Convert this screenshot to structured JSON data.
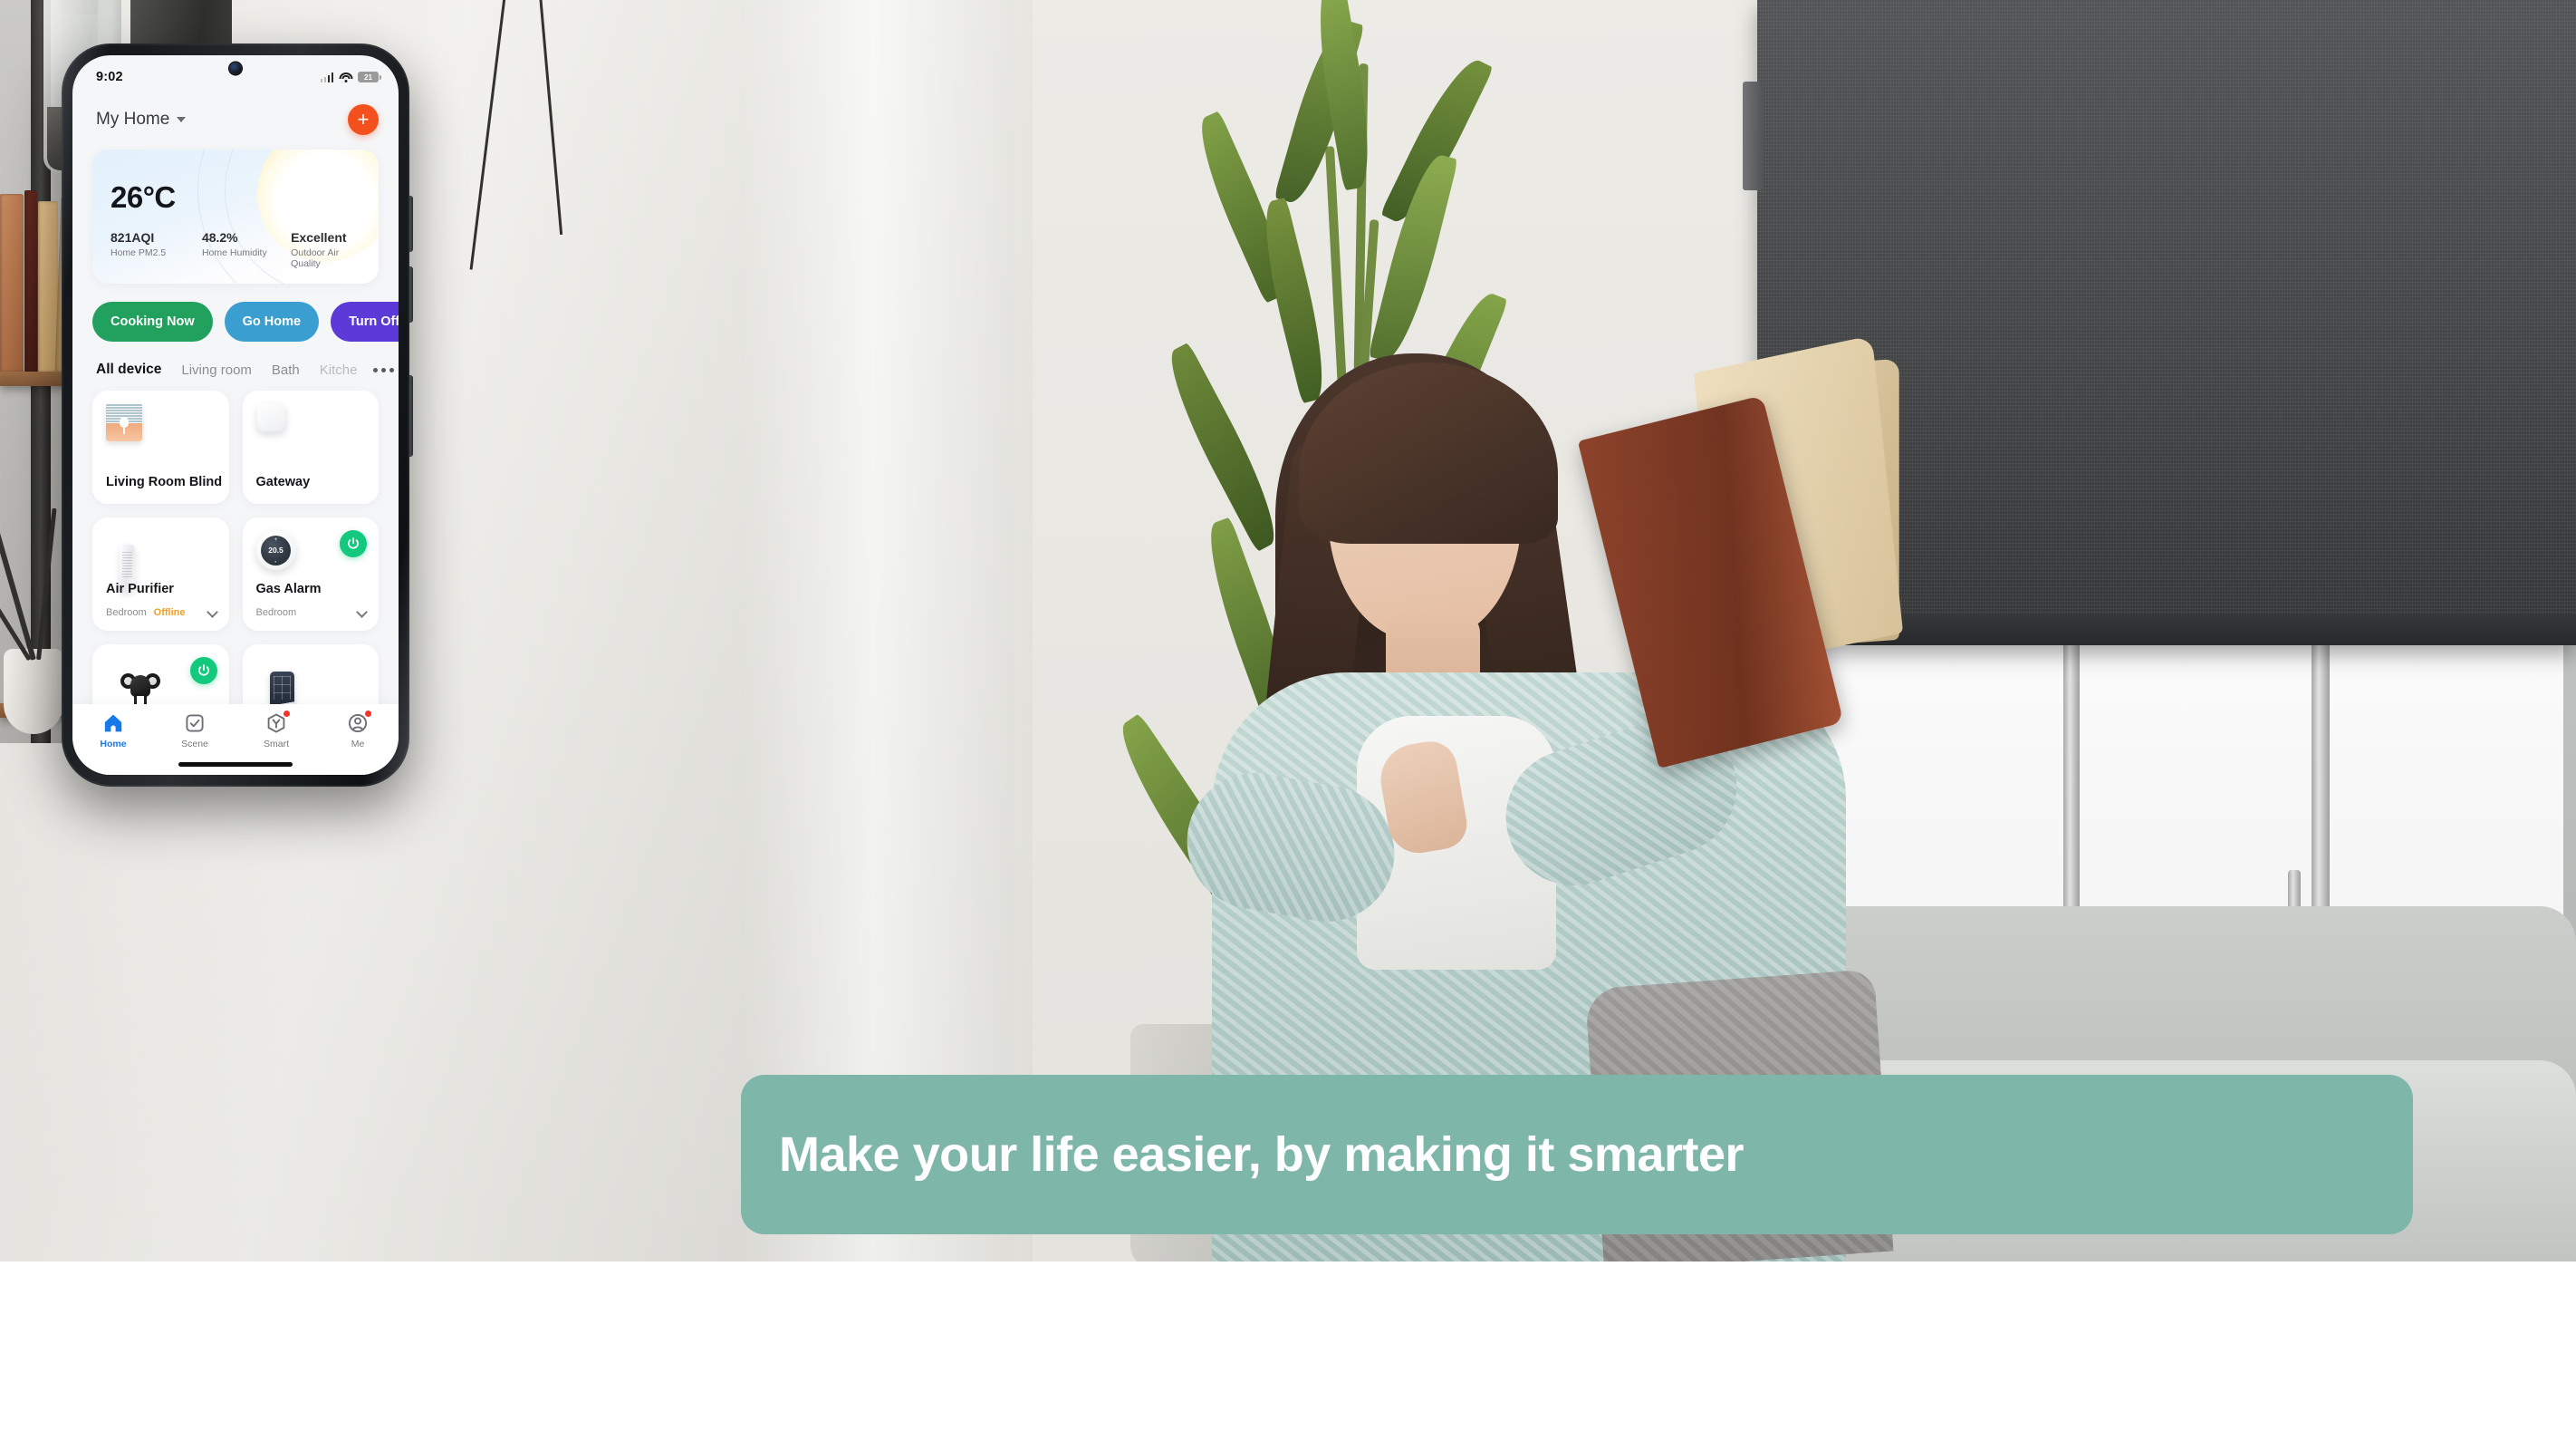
{
  "banner": {
    "text": "Make your life easier, by making it smarter",
    "bg_color": "#7eb6aa",
    "text_color": "#ffffff"
  },
  "phone": {
    "status_bar": {
      "time": "9:02",
      "battery_level": "21",
      "signal_icon": "cellular-signal-icon",
      "wifi_icon": "wifi-icon",
      "battery_icon": "battery-icon"
    },
    "header": {
      "home_name": "My Home",
      "dropdown_icon": "chevron-down-icon",
      "add_label": "+",
      "add_icon": "plus-icon",
      "add_color": "#f4501e"
    },
    "weather_card": {
      "temperature": "26°C",
      "stats": [
        {
          "value": "821AQI",
          "label": "Home PM2.5"
        },
        {
          "value": "48.2%",
          "label": "Home Humidity"
        },
        {
          "value": "Excellent",
          "label": "Outdoor Air Quality"
        }
      ]
    },
    "scenes": [
      {
        "label": "Cooking Now",
        "color": "#22a05e"
      },
      {
        "label": "Go Home",
        "color": "#3a9fd0"
      },
      {
        "label": "Turn Off All Li",
        "color": "#5b3ad8"
      }
    ],
    "tabs": [
      {
        "label": "All device",
        "state": "active"
      },
      {
        "label": "Living room",
        "state": "normal"
      },
      {
        "label": "Bath",
        "state": "normal"
      },
      {
        "label": "Kitche",
        "state": "faded"
      }
    ],
    "tabs_more_icon": "more-horizontal-icon",
    "devices": [
      {
        "name": "Living Room Blind",
        "room": "",
        "status": "",
        "icon": "window-blind-icon",
        "power": false,
        "chevron": false
      },
      {
        "name": "Gateway",
        "room": "",
        "status": "",
        "icon": "gateway-hub-icon",
        "power": false,
        "chevron": false
      },
      {
        "name": "Air Purifier",
        "room": "Bedroom",
        "status": "Offline",
        "icon": "air-purifier-icon",
        "power": false,
        "chevron": true
      },
      {
        "name": "Gas Alarm",
        "room": "Bedroom",
        "status": "",
        "icon": "thermostat-icon",
        "thermostat_value": "20.5",
        "power": true,
        "chevron": true
      },
      {
        "name": "",
        "room": "",
        "status": "",
        "icon": "camera-icon",
        "power": true,
        "chevron": false
      },
      {
        "name": "",
        "room": "",
        "status": "",
        "icon": "keypad-icon",
        "power": false,
        "chevron": false
      }
    ],
    "nav": [
      {
        "label": "Home",
        "icon": "home-icon",
        "active": true,
        "badge": false
      },
      {
        "label": "Scene",
        "icon": "scene-checkbox-icon",
        "active": false,
        "badge": false
      },
      {
        "label": "Smart",
        "icon": "smart-automation-icon",
        "active": false,
        "badge": true
      },
      {
        "label": "Me",
        "icon": "profile-icon",
        "active": false,
        "badge": true
      }
    ],
    "nav_active_color": "#1878e8",
    "badge_color": "#f8342a"
  }
}
